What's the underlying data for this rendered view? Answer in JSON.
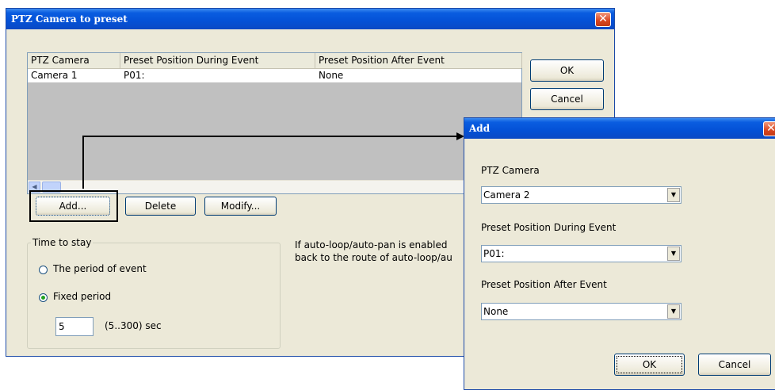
{
  "main_dialog": {
    "title": "PTZ Camera to preset",
    "close_glyph": "✕",
    "table": {
      "columns": [
        "PTZ Camera",
        "Preset Position During Event",
        "Preset Position After Event"
      ],
      "rows": [
        {
          "camera": "Camera 1",
          "during": "P01:",
          "after": "None"
        }
      ]
    },
    "buttons": {
      "ok": "OK",
      "cancel": "Cancel",
      "add": "Add...",
      "delete": "Delete",
      "modify": "Modify..."
    },
    "time_to_stay": {
      "group_label": "Time to stay",
      "option_event": "The period of event",
      "option_fixed": "Fixed period",
      "fixed_value": "5",
      "range_label": "(5..300) sec",
      "selected": "fixed"
    },
    "note_line1": "If auto-loop/auto-pan is enabled",
    "note_line2": "back to the route of auto-loop/au"
  },
  "add_dialog": {
    "title": "Add",
    "ptz_camera_label": "PTZ Camera",
    "ptz_camera_value": "Camera 2",
    "during_label": "Preset Position During Event",
    "during_value": "P01:",
    "after_label": "Preset Position After Event",
    "after_value": "None",
    "ok": "OK",
    "cancel": "Cancel"
  },
  "colors": {
    "titlebar": "#0451d6",
    "dialog_bg": "#ece9d8",
    "close_button": "#d9451f"
  },
  "icons": [
    "close-icon",
    "scroll-left-icon",
    "dropdown-arrow-icon",
    "radio-icon"
  ]
}
